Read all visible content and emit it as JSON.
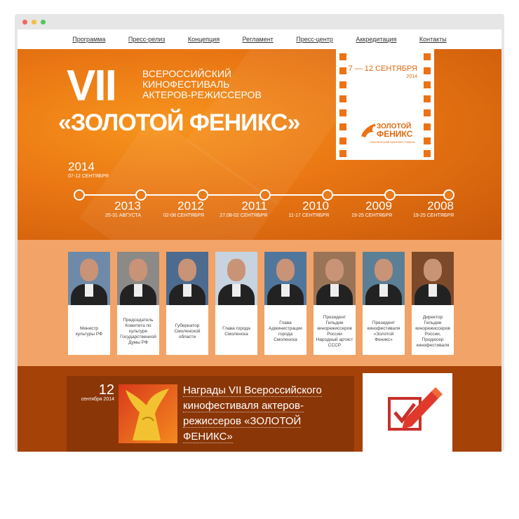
{
  "nav": {
    "items": [
      "Программа",
      "Пресс-релиз",
      "Концепция",
      "Регламент",
      "Пресс-центр",
      "Аккредитация",
      "Контакты"
    ]
  },
  "hero": {
    "roman": "VII",
    "subtitle_lines": [
      "ВСЕРОССИЙСКИЙ",
      "КИНОФЕСТИВАЛЬ",
      "АКТЕРОВ-РЕЖИССЕРОВ"
    ],
    "festival_name": "«ЗОЛОТОЙ ФЕНИКС»",
    "poster": {
      "dates": "7 — 12 СЕНТЯБРЯ",
      "year": "2014",
      "logo_title_1": "ЗОЛОТОЙ",
      "logo_title_2": "ФЕНИКС",
      "logo_sub": "СМОЛЕНСКИЙ КИНОФЕСТИВАЛЬ"
    },
    "current": {
      "year": "2014",
      "dates": "07-12 СЕНТЯБРЯ"
    },
    "timeline": [
      {
        "year": "2013",
        "dates": "25-31 АВГУСТА"
      },
      {
        "year": "2012",
        "dates": "02-08 СЕНТЯБРЯ"
      },
      {
        "year": "2011",
        "dates": "27.08-02 СЕНТЯБРЯ"
      },
      {
        "year": "2010",
        "dates": "11-17 СЕНТЯБРЯ"
      },
      {
        "year": "2009",
        "dates": "19-25 СЕНТЯБРЯ"
      },
      {
        "year": "2008",
        "dates": "19-25 СЕНТЯБРЯ"
      }
    ]
  },
  "people": [
    {
      "caption": "Министр культуры РФ"
    },
    {
      "caption": "Председатель Комитета по культуре Государственной Думы РФ"
    },
    {
      "caption": "Губернатор Смоленской области"
    },
    {
      "caption": "Глава города Смоленска"
    },
    {
      "caption": "Глава Администрации города Смоленска"
    },
    {
      "caption": "Президент Гильдии кинорежиссеров России Народный артист СССР"
    },
    {
      "caption": "Президент кинофестиваля «Золотой Феникс»"
    },
    {
      "caption": "Директор Гильдии кинорежиссеров России, Продюсер кинофестиваля"
    }
  ],
  "news": {
    "day": "12",
    "month": "сентября 2014",
    "title": "Награды VII Всероссийского кинофестиваля актеров-режиссеров «ЗОЛОТОЙ ФЕНИКС»"
  },
  "colors": {
    "accent": "#ed7214",
    "hero_light": "#f7941d",
    "hero_dark": "#c9580a",
    "vote_red": "#c8302b"
  }
}
